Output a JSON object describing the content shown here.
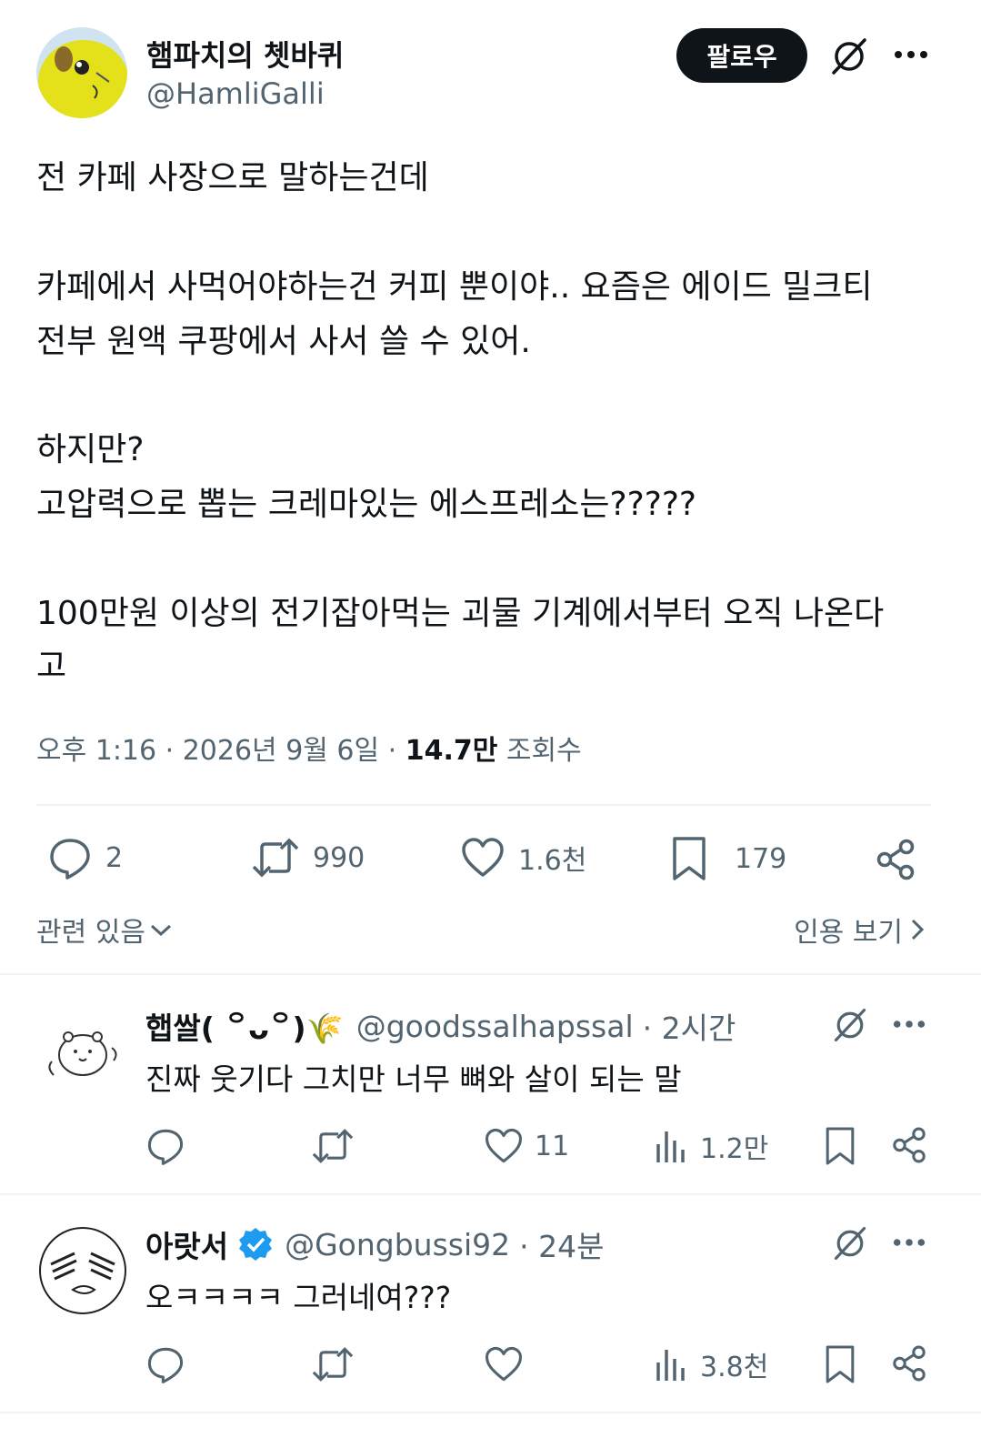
{
  "author": {
    "name": "햄파치의 쳇바퀴",
    "handle": "@HamliGalli"
  },
  "follow_label": "팔로우",
  "tweet": {
    "lines": [
      "전 카페 사장으로 말하는건데",
      "카페에서 사먹어야하는건 커피 뿐이야.. 요즘은  에이드 밀크티",
      "전부 원액 쿠팡에서 사서 쓸 수 있어.",
      "하지만?",
      "고압력으로 뽑는 크레마있는 에스프레소는?????",
      "100만원 이상의 전기잡아먹는 괴물 기계에서부터 오직 나온다",
      "고"
    ]
  },
  "meta": {
    "time": "오후 1:16 · 2026년 9월 6일 · ",
    "views_count": "14.7만",
    "views_label": " 조회수"
  },
  "actions": {
    "replies": "2",
    "reposts": "990",
    "likes": "1.6천",
    "bookmarks": "179"
  },
  "related_label": "관련 있음",
  "quotes_label": "인용 보기",
  "replies": [
    {
      "name": "햅쌀( ꒪ᴗ꒪)🌾",
      "handle": "@goodssalhapssal",
      "time": "· 2시간",
      "text": "진짜 웃기다 그치만 너무 뼈와 살이 되는 말",
      "reply_count": "",
      "repost_count": "",
      "like_count": "11",
      "views": "1.2만",
      "verified": false
    },
    {
      "name": "아랏서",
      "handle": "@Gongbussi92",
      "time": "· 24분",
      "text": "오ㅋㅋㅋㅋ 그러네여???",
      "reply_count": "",
      "repost_count": "",
      "like_count": "",
      "views": "3.8천",
      "verified": true
    }
  ],
  "colors": {
    "text": "#0f1419",
    "secondary": "#536471",
    "follow_bg": "#0f1419",
    "verified": "#1d9bf0",
    "divider": "#eff3f4"
  },
  "icons": [
    "grok-icon",
    "more-icon",
    "reply-icon",
    "repost-icon",
    "like-icon",
    "bookmark-icon",
    "share-icon",
    "views-icon",
    "chevron-down-icon",
    "chevron-right-icon",
    "verified-icon"
  ]
}
